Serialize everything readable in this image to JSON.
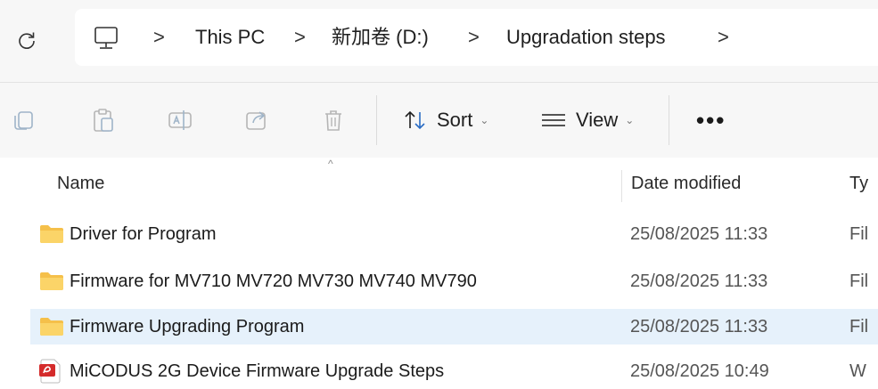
{
  "address": {
    "crumbs": [
      "This PC",
      "新加卷 (D:)",
      "Upgradation steps"
    ],
    "separator": ">"
  },
  "toolbar": {
    "sort_label": "Sort",
    "view_label": "View",
    "more_label": "•••",
    "chevron": "⌄"
  },
  "columns": {
    "name": "Name",
    "date": "Date modified",
    "type": "Ty",
    "sort_indicator": "^"
  },
  "files": [
    {
      "name": "Driver for Program",
      "date": "25/08/2025 11:33",
      "type": "Fil",
      "icon": "folder-icon",
      "selected": false
    },
    {
      "name": "Firmware for MV710 MV720 MV730 MV740 MV790",
      "date": "25/08/2025 11:33",
      "type": "Fil",
      "icon": "folder-icon",
      "selected": false
    },
    {
      "name": "Firmware Upgrading Program",
      "date": "25/08/2025 11:33",
      "type": "Fil",
      "icon": "folder-icon",
      "selected": true
    },
    {
      "name": "MiCODUS 2G Device Firmware Upgrade Steps",
      "date": "25/08/2025 10:49",
      "type": "W",
      "icon": "pdf-icon",
      "selected": false
    }
  ],
  "colors": {
    "folder": "#f5c04a",
    "selected_row": "#e6f1fb",
    "pdf": "#d42b2b"
  }
}
